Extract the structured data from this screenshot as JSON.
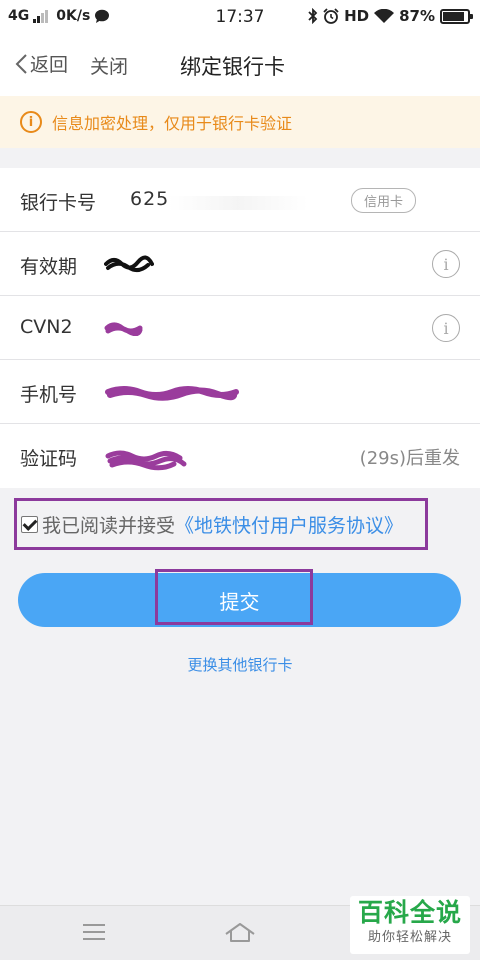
{
  "status_bar": {
    "network": "4G",
    "speed": "0K/s",
    "time": "17:37",
    "hd": "HD",
    "battery": "87%",
    "battery_level": 0.87
  },
  "nav": {
    "back_label": "返回",
    "close_label": "关闭",
    "title": "绑定银行卡"
  },
  "notice": {
    "icon_glyph": "i",
    "text": "信息加密处理，仅用于银行卡验证",
    "color": "#e88a1a"
  },
  "form": {
    "card_number": {
      "label": "银行卡号",
      "value": "625",
      "tag": "信用卡"
    },
    "expiry": {
      "label": "有效期",
      "info_glyph": "i"
    },
    "cvn2": {
      "label": "CVN2",
      "info_glyph": "i"
    },
    "phone": {
      "label": "手机号"
    },
    "code": {
      "label": "验证码",
      "resend": "(29s)后重发"
    }
  },
  "agreement": {
    "checked": true,
    "text": "我已阅读并接受",
    "link": "《地铁快付用户服务协议》"
  },
  "submit_label": "提交",
  "change_card_label": "更换其他银行卡",
  "watermark": {
    "title": "百科全说",
    "subtitle": "助你轻松解决"
  },
  "colors": {
    "accent": "#4aa6f5",
    "link": "#3b8ee6",
    "highlight": "#8c3a9c"
  }
}
